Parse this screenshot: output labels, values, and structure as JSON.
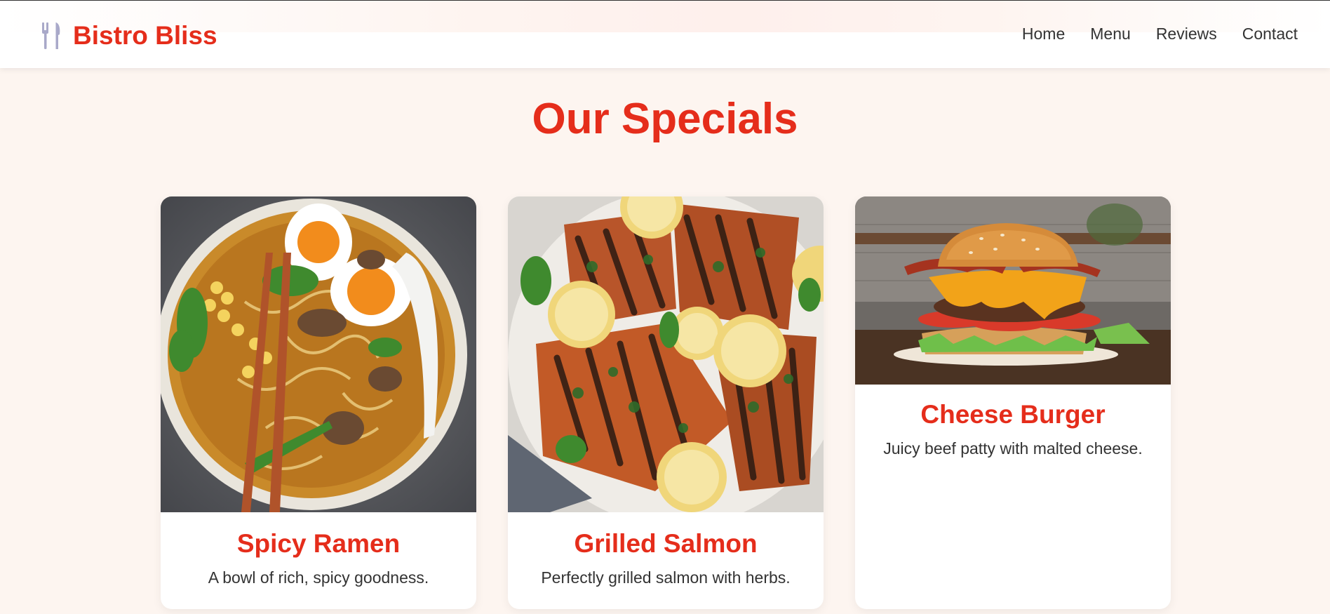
{
  "brand": {
    "name": "Bistro Bliss",
    "icon": "utensils-icon",
    "color": "#e52d1b"
  },
  "nav": {
    "items": [
      {
        "label": "Home"
      },
      {
        "label": "Menu"
      },
      {
        "label": "Reviews"
      },
      {
        "label": "Contact"
      }
    ]
  },
  "specials": {
    "title": "Our Specials",
    "items": [
      {
        "name": "Spicy Ramen",
        "description": "A bowl of rich, spicy goodness.",
        "image": "ramen-bowl-photo"
      },
      {
        "name": "Grilled Salmon",
        "description": "Perfectly grilled salmon with herbs.",
        "image": "grilled-salmon-photo"
      },
      {
        "name": "Cheese Burger",
        "description": "Juicy beef patty with malted cheese.",
        "image": "cheese-burger-photo"
      }
    ]
  },
  "colors": {
    "accent": "#e52d1b",
    "background": "#fdf5f0",
    "text": "#333333"
  }
}
